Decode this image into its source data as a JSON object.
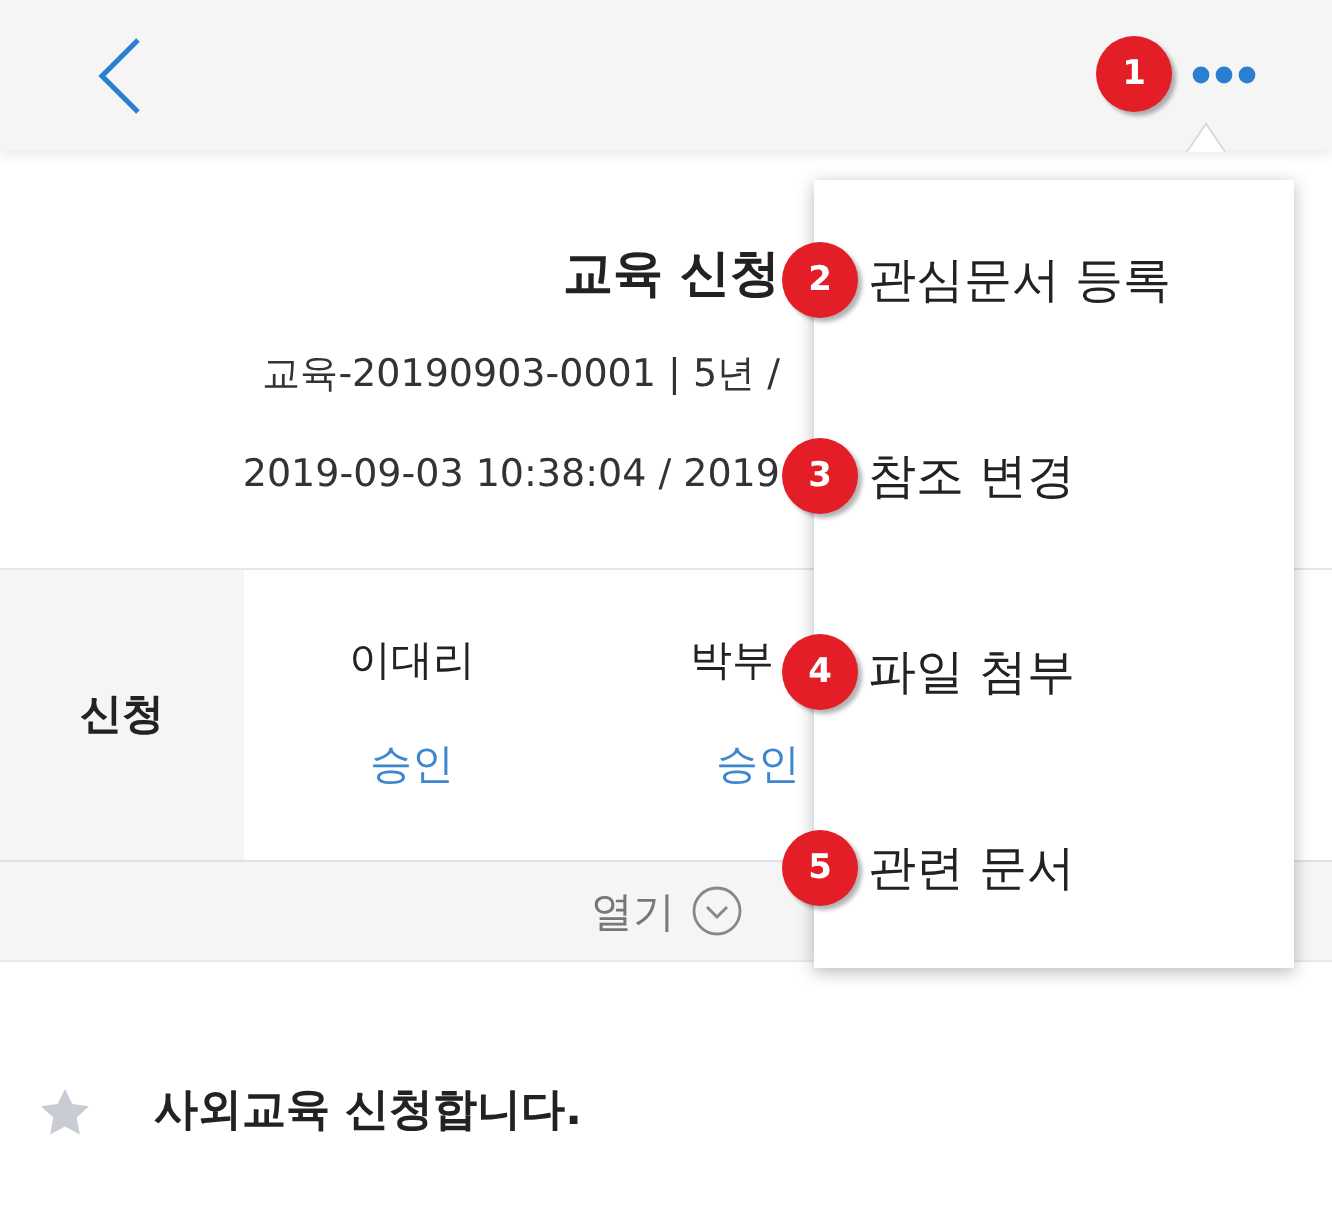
{
  "header": {
    "more_badge": "1"
  },
  "document": {
    "title": "교육 신청",
    "number_line": "교육-20190903-0001 | 5년 /",
    "date_line": "2019-09-03 10:38:04 / 2019"
  },
  "approval": {
    "label": "신청",
    "approvers": [
      {
        "name": "이대리",
        "status": "승인"
      },
      {
        "name": "박부",
        "status": "승인"
      }
    ]
  },
  "expand": {
    "label": "열기"
  },
  "post": {
    "starred": false,
    "subject": "사외교육 신청합니다."
  },
  "menu": {
    "items": [
      {
        "label": "관심문서 등록",
        "badge": "2"
      },
      {
        "label": "참조 변경",
        "badge": "3"
      },
      {
        "label": "파일 첨부",
        "badge": "4"
      },
      {
        "label": "관련 문서",
        "badge": "5"
      }
    ]
  }
}
